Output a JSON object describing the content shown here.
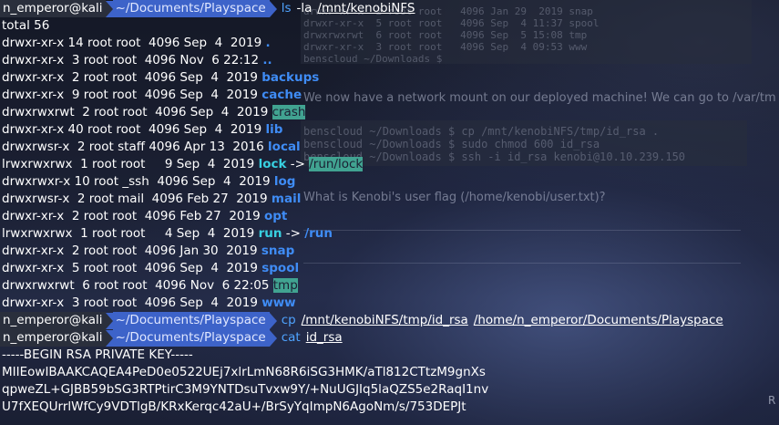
{
  "colors": {
    "prompt_user_bg": "#2a2f3c",
    "prompt_dir_bg": "#3d63c9",
    "dir_color": "#3f8cf5",
    "symlink_color": "#38d0e0",
    "sticky_highlight": "#41a391"
  },
  "prompt": {
    "user": "n_emperor@kali",
    "dir": "~/Documents/Playspace"
  },
  "cmd1": {
    "name": "ls",
    "flags": "-la",
    "arg": "/mnt/kenobiNFS"
  },
  "listing": {
    "total": "total 56",
    "rows": [
      {
        "perm": "drwxr-xr-x 14 root root  4096 Sep  4  2019 ",
        "name": "."
      },
      {
        "perm": "drwxr-xr-x  3 root root  4096 Nov  6 22:12 ",
        "name": ".."
      },
      {
        "perm": "drwxr-xr-x  2 root root  4096 Sep  4  2019 ",
        "name": "backups"
      },
      {
        "perm": "drwxr-xr-x  9 root root  4096 Sep  4  2019 ",
        "name": "cache"
      },
      {
        "perm": "drwxrwxrwt  2 root root  4096 Sep  4  2019 ",
        "name": "crash"
      },
      {
        "perm": "drwxr-xr-x 40 root root  4096 Sep  4  2019 ",
        "name": "lib"
      },
      {
        "perm": "drwxrwsr-x  2 root staff 4096 Apr 13  2016 ",
        "name": "local"
      },
      {
        "perm": "lrwxrwxrwx  1 root root     9 Sep  4  2019 ",
        "name": "lock",
        "arrow": " -> ",
        "target": "/run/lock"
      },
      {
        "perm": "drwxrwxr-x 10 root _ssh  4096 Sep  4  2019 ",
        "name": "log"
      },
      {
        "perm": "drwxrwsr-x  2 root mail  4096 Feb 27  2019 ",
        "name": "mail"
      },
      {
        "perm": "drwxr-xr-x  2 root root  4096 Feb 27  2019 ",
        "name": "opt"
      },
      {
        "perm": "lrwxrwxrwx  1 root root     4 Sep  4  2019 ",
        "name": "run",
        "arrow": " -> ",
        "target": "/run"
      },
      {
        "perm": "drwxr-xr-x  2 root root  4096 Jan 30  2019 ",
        "name": "snap"
      },
      {
        "perm": "drwxr-xr-x  5 root root  4096 Sep  4  2019 ",
        "name": "spool"
      },
      {
        "perm": "drwxrwxrwt  6 root root  4096 Nov  6 22:05 ",
        "name": "tmp"
      },
      {
        "perm": "drwxr-xr-x  3 root root  4096 Sep  4  2019 ",
        "name": "www"
      }
    ]
  },
  "cmd2": {
    "name": "cp",
    "arg1": "/mnt/kenobiNFS/tmp/id_rsa",
    "arg2": "/home/n_emperor/Documents/Playspace"
  },
  "cmd3": {
    "name": "cat",
    "arg": "id_rsa"
  },
  "key": {
    "header": "-----BEGIN RSA PRIVATE KEY-----",
    "lines": [
      "MIIEowIBAAKCAQEA4PeD0e0522UEj7xlrLmN68R6iSG3HMK/aTl812CTtzM9gnXs",
      "qpweZL+GJBB59bSG3RTPtirC3M9YNTDsuTvxw9Y/+NuUGJIq5laQZS5e2RaqI1nv",
      "U7fXEQUrrlWfCy9VDTlgB/KRxKerqc42aU+/BrSyYqImpN6AgoNm/s/753DEPJt"
    ]
  },
  "background_web": {
    "sentence1": "We now have a network mount on our deployed machine! We can go to /var/tm",
    "sentence2": "What is Kenobi's user flag (/home/kenobi/user.txt)?",
    "edge_char": "R"
  }
}
